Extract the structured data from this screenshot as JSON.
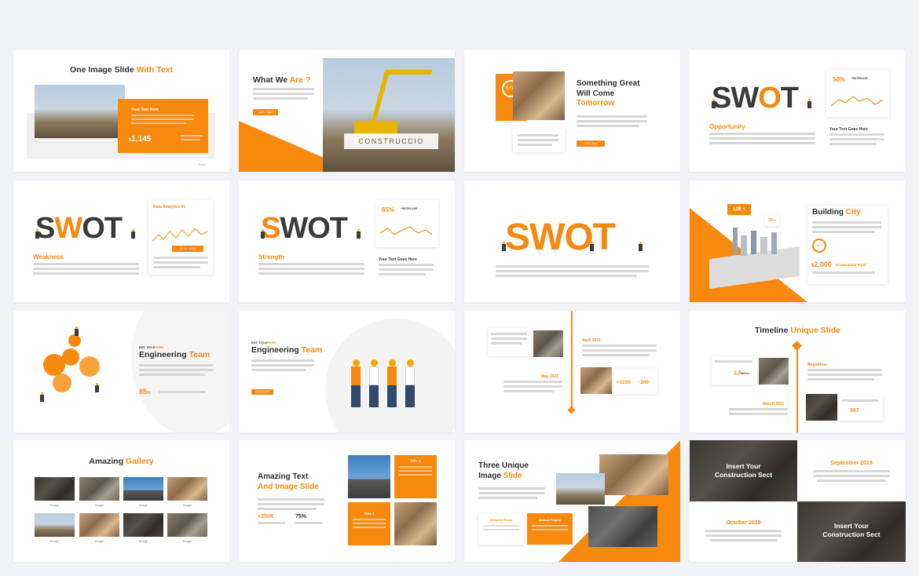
{
  "slides": {
    "s1": {
      "title_a": "One Image Slide ",
      "title_b": "With Text",
      "box_title": "Your Text Here",
      "value": "1.145",
      "currency": "$"
    },
    "s2": {
      "title_a": "What We ",
      "title_b": "Are ?",
      "banner": "CONSTRUCCIO",
      "button": "Let's Start"
    },
    "s3": {
      "line1": "Something Great",
      "line2": "Will Come",
      "line3": "Tomorrow",
      "percent": "57%",
      "button": "Let's Start"
    },
    "s4": {
      "swot": [
        "S",
        "W",
        "O",
        "T"
      ],
      "label": "Opportunity",
      "stat": "50%",
      "code": "*5675%139",
      "caption": "Your Text Goes Here"
    },
    "s5": {
      "swot": [
        "S",
        "W",
        "O",
        "T"
      ],
      "label": "Weakness",
      "chart_title": "Data Analytics #1",
      "date": "09-01-2019"
    },
    "s6": {
      "swot": [
        "S",
        "W",
        "O",
        "T"
      ],
      "label": "Strength",
      "stat": "65%",
      "code": "*5675%139",
      "caption": "Your Text Goes Here"
    },
    "s7": {
      "swot": [
        "S",
        "W",
        "O",
        "T"
      ]
    },
    "s8": {
      "title_a": "Building ",
      "title_b": "City",
      "badge1": "12B +",
      "badge2": "30 +",
      "badge3": "30%",
      "amount": "2.000",
      "amount_label": "Government Fund",
      "currency": "$"
    },
    "s9": {
      "small_a": "ENT TITLE",
      "small_b": "HERE",
      "title_a": "Engineering ",
      "title_b": "Team",
      "percent": "85",
      "percent_sign": "%"
    },
    "s10": {
      "small_a": "ENT TITLE",
      "small_b": "HERE",
      "title_a": "Engineering ",
      "title_b": "Team",
      "button": "Read More"
    },
    "s11": {
      "date1": "April 2021",
      "date2": "May 2021",
      "stat1": "+1150",
      "stat2": "-200"
    },
    "s12": {
      "title_a": "Timeline ",
      "title_b": "Unique Slide",
      "begin": "BeginNow",
      "date": "March 2021",
      "stat1": "1,9",
      "stat1_suffix": "Billion",
      "stat2": "367"
    },
    "s13": {
      "title_a": "Amazing ",
      "title_b": "Gallery",
      "image_label": "Image"
    },
    "s14": {
      "line1": "Amazing Text",
      "line2": "And Image Slide",
      "stat1": "+250K",
      "stat2": "75%",
      "t1": "Title 1",
      "t2": "Title 2"
    },
    "s15": {
      "line1": "Three  Unique",
      "line2_a": "Image ",
      "line2_b": "Slide",
      "card1": "Shoprint Relay",
      "card2": "Motion Project"
    },
    "s16": {
      "q1": "Insert Your",
      "q1b": "Construction Sect",
      "q2": "September 2019",
      "q3": "October 2019",
      "q4": "Insert Your",
      "q4b": "Construction Sect"
    },
    "page_label": "Page"
  },
  "colors": {
    "accent": "#f7890f",
    "text": "#2d2d2d",
    "background": "#f2f3f7"
  }
}
